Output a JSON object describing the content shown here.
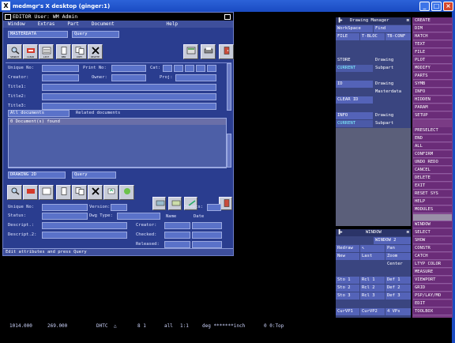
{
  "host": {
    "title": "medmgr's X desktop (ginger:1)"
  },
  "editor": {
    "title": "EDITOR User: WM Admin",
    "menu": [
      "Window",
      "Extras",
      "Part",
      "Document",
      "Help"
    ],
    "masterdata_field": "MASTERDATA",
    "query_field": "Query",
    "top_toolbar": [
      {
        "icon": "search-icon",
        "caption": "SEARCH"
      },
      {
        "icon": "clear-icon",
        "caption": "CLEAR"
      },
      {
        "icon": "list-icon",
        "caption": "LIST"
      },
      {
        "icon": "new-icon",
        "caption": "NEW"
      },
      {
        "icon": "copy-icon",
        "caption": "COPY"
      },
      {
        "icon": "delete-icon",
        "caption": "DELETE"
      }
    ],
    "labels": {
      "unique_no": "Unique No:",
      "print_no": "Print No:",
      "cat": "Cat:",
      "creator": "Creator:",
      "owner": "Owner:",
      "proj": "Proj:",
      "title1": "Title1:",
      "title2": "Title2:",
      "title3": "Title3:"
    },
    "all_documents": "All documents",
    "related_documents": "Related documents",
    "doc_count": "0 Document(s) found",
    "drawing_field": "DRAWING 2D",
    "drawing_query": "Query",
    "lower_labels": {
      "unique_no": "Unique No:",
      "version": "Version:",
      "sheets": "Sheets:",
      "status": "Status:",
      "dwg_type": "Dwg Type:",
      "name": "Name",
      "date": "Date",
      "descript1": "Descript.:",
      "descript2": "Descript.2:",
      "creator": "Creator:",
      "checked": "Checked:",
      "released": "Released:"
    },
    "status_text": "Edit attributes and press Query"
  },
  "drawing_manager": {
    "title": "Drawing Manager",
    "workspace": "WorkSpace",
    "find": "Find",
    "file": "FILE",
    "t_bloc": "T-BLOC",
    "tb_conf": "TB-CONF",
    "store": "STORE",
    "drawing1": "Drawing",
    "current1": "CURRENT",
    "subpart1": "Subpart",
    "id": "ID",
    "drawing2": "Drawing",
    "masterdata": "Masterdata",
    "clear_id": "CLEAR ID",
    "info": "INFO",
    "drawing3": "Drawing",
    "current2": "CURRENT",
    "subpart2": "Subpart"
  },
  "window_panel": {
    "title": "WINDOW",
    "window2": "WINDOW 2",
    "redraw": "Redraw",
    "pan": "Pan",
    "new": "New",
    "last": "Last",
    "zoom": "Zoom",
    "center": "Center",
    "rows": [
      [
        "Sto 1",
        "Rcl 1",
        "Def 1"
      ],
      [
        "Sto 2",
        "Rcl 2",
        "Def 2"
      ],
      [
        "Sto 3",
        "Rcl 3",
        "Def 3"
      ]
    ],
    "curvp1": "CurVP1",
    "curvp2": "CurVP2",
    "vps": "4 VPs"
  },
  "commands_top": [
    "CREATE",
    "DIM",
    "HATCH",
    "TEXT",
    "FILE",
    "PLOT",
    "MODIFY",
    "PARTS",
    "SYMB",
    "INFO",
    "HIDDEN",
    "PARAM",
    "SETUP"
  ],
  "commands_mid": [
    "PRESELECT",
    "END",
    "ALL",
    "CONFIRM",
    "UNDO REDO",
    "CANCEL",
    "DELETE",
    "EXIT",
    "RESET SYS",
    "HELP",
    "MODULES"
  ],
  "commands_bot": [
    "WINDOW",
    "SELECT",
    "SHOW",
    "CONSTR",
    "CATCH",
    "LTYP COLOR",
    "MEASURE",
    "VIEWPORT",
    "GRID",
    "PSP/LAY/MO",
    "EDIT",
    "TOOLBOX"
  ],
  "status": {
    "x": "1014.000",
    "y": "269.000",
    "mode": "DHTC",
    "scale": "8 1",
    "all": "all",
    "ratio": "1:1",
    "unit": "deg *******inch",
    "view": "0 0:Top"
  }
}
